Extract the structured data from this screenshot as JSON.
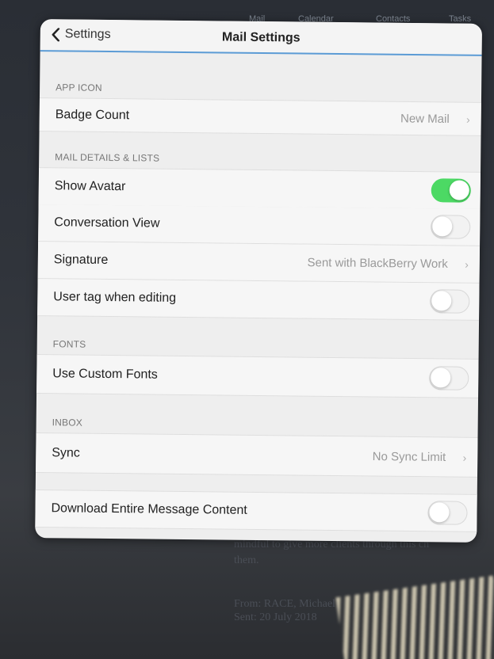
{
  "background": {
    "tabs": [
      "Mail",
      "Calendar",
      "Contacts",
      "Tasks"
    ],
    "text_lines": [
      "mindful to give more clients through this ch",
      "them.",
      "From: RACE, Michael",
      "Sent: 20 July 2018"
    ]
  },
  "navbar": {
    "back_label": "Settings",
    "title": "Mail Settings"
  },
  "sections": {
    "app_icon": {
      "header": "APP ICON",
      "badge_count": {
        "label": "Badge Count",
        "value": "New Mail"
      }
    },
    "mail_details": {
      "header": "MAIL DETAILS & LISTS",
      "show_avatar": {
        "label": "Show Avatar",
        "on": true
      },
      "conversation_view": {
        "label": "Conversation View",
        "on": false
      },
      "signature": {
        "label": "Signature",
        "value": "Sent with BlackBerry Work"
      },
      "user_tag": {
        "label": "User tag when editing",
        "on": false
      }
    },
    "fonts": {
      "header": "FONTS",
      "use_custom_fonts": {
        "label": "Use Custom Fonts",
        "on": false
      }
    },
    "inbox": {
      "header": "INBOX",
      "sync": {
        "label": "Sync",
        "value": "No Sync Limit"
      }
    },
    "download": {
      "download_entire": {
        "label": "Download Entire Message Content",
        "on": false
      }
    }
  },
  "colors": {
    "toggle_on": "#4cd964",
    "nav_accent": "#5b9bd5"
  }
}
